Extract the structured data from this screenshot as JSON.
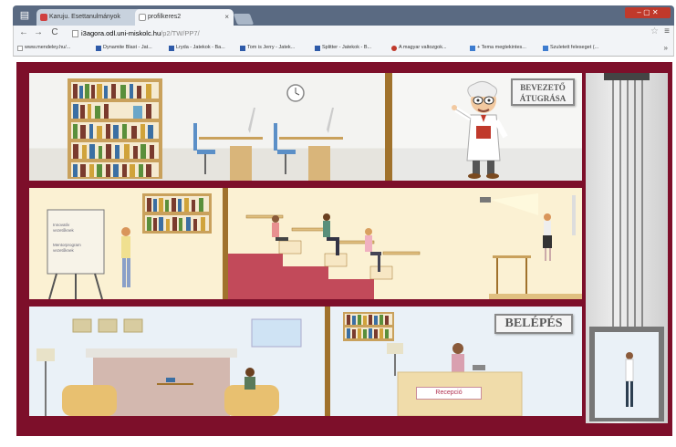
{
  "browser": {
    "tabs": [
      {
        "label": "Karuju. Esettanulmányok",
        "active": false
      },
      {
        "label": "profilkeres2",
        "active": true
      }
    ],
    "url_domain": "i3agora.odl.uni-miskolc.hu",
    "url_path": "/p2/TW/PP7/",
    "url_scheme": "",
    "bookmarks": [
      {
        "label": "www.mendeley.hu/...",
        "icon": "page"
      },
      {
        "label": "Dynamite Blast - Jat...",
        "icon": "blue"
      },
      {
        "label": "Lryda - Jatekok - Ba...",
        "icon": "blue"
      },
      {
        "label": "Tom is Jerry - Jatek...",
        "icon": "blue"
      },
      {
        "label": "Splitter - Jatekok - B...",
        "icon": "blue"
      },
      {
        "label": "A magyar valtozgok...",
        "icon": "red"
      },
      {
        "label": "+ Tema megtekintes...",
        "icon": "blue"
      },
      {
        "label": "Szuletett feleseget (...",
        "icon": "blue"
      }
    ]
  },
  "game": {
    "bevezeto_button": "BEVEZETŐ ÁTUGRÁSA",
    "belepes_button": "BELÉPÉS",
    "reception_sign": "Recepció",
    "poster_lines": [
      "Innovatív",
      "vezetőknek",
      "Mentorprogram",
      "vezetőknek"
    ]
  },
  "colors": {
    "frame": "#7d0f2a",
    "floor_wood": "#a0722c",
    "lecture_carpet": "#c24a5a"
  }
}
